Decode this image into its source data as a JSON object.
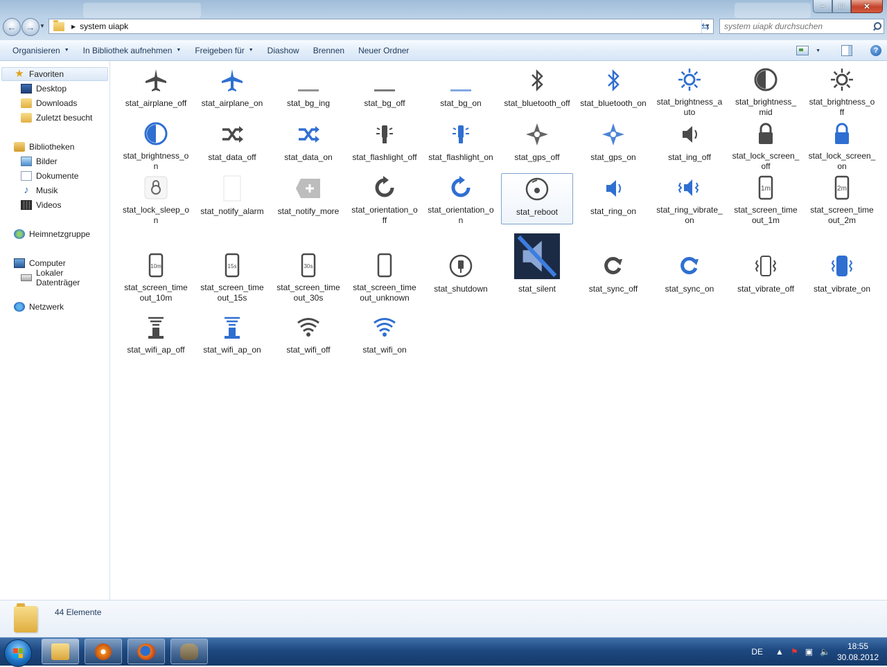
{
  "window": {
    "address_path": "system uiapk",
    "search_placeholder": "system uiapk durchsuchen",
    "min_icon": "minimize-icon",
    "max_icon": "maximize-icon",
    "close_icon": "close-icon"
  },
  "toolbar": {
    "organize": "Organisieren",
    "include_library": "In Bibliothek aufnehmen",
    "share": "Freigeben für",
    "slideshow": "Diashow",
    "burn": "Brennen",
    "new_folder": "Neuer Ordner",
    "help": "?"
  },
  "nav": {
    "favorites": "Favoriten",
    "desktop": "Desktop",
    "downloads": "Downloads",
    "recent": "Zuletzt besucht",
    "libraries": "Bibliotheken",
    "pictures": "Bilder",
    "documents": "Dokumente",
    "music": "Musik",
    "videos": "Videos",
    "homegroup": "Heimnetzgruppe",
    "computer": "Computer",
    "local_disk": "Lokaler Datenträger",
    "network": "Netzwerk"
  },
  "files": [
    {
      "name": "stat_airplane_off",
      "icon": "airplane",
      "style": "gray"
    },
    {
      "name": "stat_airplane_on",
      "icon": "airplane",
      "style": "blue"
    },
    {
      "name": "stat_bg_ing",
      "icon": "bar",
      "style": "gray"
    },
    {
      "name": "stat_bg_off",
      "icon": "bar",
      "style": "dark"
    },
    {
      "name": "stat_bg_on",
      "icon": "bar",
      "style": "blue"
    },
    {
      "name": "stat_bluetooth_off",
      "icon": "bluetooth",
      "style": "gray"
    },
    {
      "name": "stat_bluetooth_on",
      "icon": "bluetooth",
      "style": "blue"
    },
    {
      "name": "stat_brightness_auto",
      "icon": "sun",
      "style": "blue"
    },
    {
      "name": "stat_brightness_mid",
      "icon": "halfcircle",
      "style": "gray"
    },
    {
      "name": "stat_brightness_off",
      "icon": "sun",
      "style": "gray"
    },
    {
      "name": "stat_brightness_on",
      "icon": "halfcircle",
      "style": "blue"
    },
    {
      "name": "stat_data_off",
      "icon": "shuffle",
      "style": "gray"
    },
    {
      "name": "stat_data_on",
      "icon": "shuffle",
      "style": "blue"
    },
    {
      "name": "stat_flashlight_off",
      "icon": "flashlight",
      "style": "gray"
    },
    {
      "name": "stat_flashlight_on",
      "icon": "flashlight",
      "style": "blue"
    },
    {
      "name": "stat_gps_off",
      "icon": "compass",
      "style": "gray"
    },
    {
      "name": "stat_gps_on",
      "icon": "compass",
      "style": "blue"
    },
    {
      "name": "stat_ing_off",
      "icon": "speaker",
      "style": "gray"
    },
    {
      "name": "stat_lock_screen_off",
      "icon": "lock",
      "style": "gray"
    },
    {
      "name": "stat_lock_screen_on",
      "icon": "lock",
      "style": "blue"
    },
    {
      "name": "stat_lock_sleep_on",
      "icon": "locksleep",
      "style": "gray"
    },
    {
      "name": "stat_notify_alarm",
      "icon": "blank",
      "style": "gray"
    },
    {
      "name": "stat_notify_more",
      "icon": "plus",
      "style": "gray"
    },
    {
      "name": "stat_orientation_off",
      "icon": "rotate",
      "style": "gray"
    },
    {
      "name": "stat_orientation_on",
      "icon": "rotate",
      "style": "blue"
    },
    {
      "name": "stat_reboot",
      "icon": "reboot",
      "style": "gray"
    },
    {
      "name": "stat_ring_on",
      "icon": "speaker",
      "style": "blue"
    },
    {
      "name": "stat_ring_vibrate_on",
      "icon": "speakervib",
      "style": "blue"
    },
    {
      "name": "stat_screen_timeout_1m",
      "icon": "phone",
      "style": "gray",
      "text": "1m"
    },
    {
      "name": "stat_screen_timeout_2m",
      "icon": "phone",
      "style": "gray",
      "text": "2m"
    },
    {
      "name": "stat_screen_timeout_10m",
      "icon": "phone",
      "style": "gray",
      "text": "10m"
    },
    {
      "name": "stat_screen_timeout_15s",
      "icon": "phone",
      "style": "gray",
      "text": "15s"
    },
    {
      "name": "stat_screen_timeout_30s",
      "icon": "phone",
      "style": "gray",
      "text": "30s"
    },
    {
      "name": "stat_screen_timeout_unknown",
      "icon": "phone",
      "style": "gray",
      "text": ""
    },
    {
      "name": "stat_shutdown",
      "icon": "power",
      "style": "gray"
    },
    {
      "name": "stat_silent",
      "icon": "silent",
      "style": "blue"
    },
    {
      "name": "stat_sync_off",
      "icon": "sync",
      "style": "gray"
    },
    {
      "name": "stat_sync_on",
      "icon": "sync",
      "style": "blue"
    },
    {
      "name": "stat_vibrate_off",
      "icon": "vibrate",
      "style": "gray"
    },
    {
      "name": "stat_vibrate_on",
      "icon": "vibrate",
      "style": "blue"
    },
    {
      "name": "stat_wifi_ap_off",
      "icon": "wifiap",
      "style": "gray"
    },
    {
      "name": "stat_wifi_ap_on",
      "icon": "wifiap",
      "style": "blue"
    },
    {
      "name": "stat_wifi_off",
      "icon": "wifi",
      "style": "gray"
    },
    {
      "name": "stat_wifi_on",
      "icon": "wifi",
      "style": "blue"
    }
  ],
  "selected_file": "stat_reboot",
  "status": {
    "count": "44 Elemente"
  },
  "taskbar": {
    "language": "DE",
    "time": "18:55",
    "date": "30.08.2012",
    "tray_icons": [
      "show-hidden-icon",
      "action-center-icon",
      "network-icon",
      "volume-icon"
    ]
  },
  "colors": {
    "icon_blue": "#2f6fd1",
    "icon_gray": "#4a4a4a",
    "taskbar": "#1d4880",
    "selection": "#7da2ce"
  }
}
